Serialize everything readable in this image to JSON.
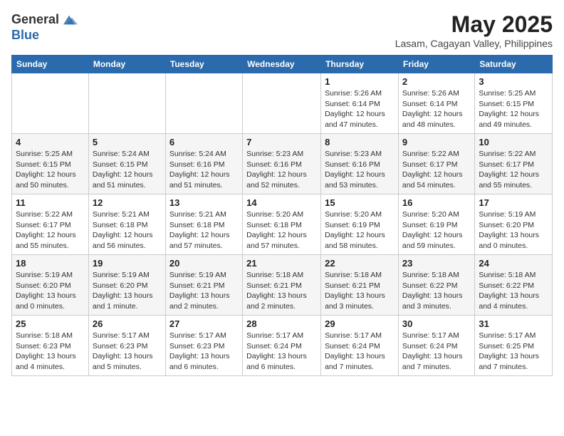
{
  "logo": {
    "general": "General",
    "blue": "Blue"
  },
  "header": {
    "month": "May 2025",
    "location": "Lasam, Cagayan Valley, Philippines"
  },
  "weekdays": [
    "Sunday",
    "Monday",
    "Tuesday",
    "Wednesday",
    "Thursday",
    "Friday",
    "Saturday"
  ],
  "weeks": [
    [
      {
        "day": "",
        "sunrise": "",
        "sunset": "",
        "daylight": ""
      },
      {
        "day": "",
        "sunrise": "",
        "sunset": "",
        "daylight": ""
      },
      {
        "day": "",
        "sunrise": "",
        "sunset": "",
        "daylight": ""
      },
      {
        "day": "",
        "sunrise": "",
        "sunset": "",
        "daylight": ""
      },
      {
        "day": "1",
        "sunrise": "Sunrise: 5:26 AM",
        "sunset": "Sunset: 6:14 PM",
        "daylight": "Daylight: 12 hours and 47 minutes."
      },
      {
        "day": "2",
        "sunrise": "Sunrise: 5:26 AM",
        "sunset": "Sunset: 6:14 PM",
        "daylight": "Daylight: 12 hours and 48 minutes."
      },
      {
        "day": "3",
        "sunrise": "Sunrise: 5:25 AM",
        "sunset": "Sunset: 6:15 PM",
        "daylight": "Daylight: 12 hours and 49 minutes."
      }
    ],
    [
      {
        "day": "4",
        "sunrise": "Sunrise: 5:25 AM",
        "sunset": "Sunset: 6:15 PM",
        "daylight": "Daylight: 12 hours and 50 minutes."
      },
      {
        "day": "5",
        "sunrise": "Sunrise: 5:24 AM",
        "sunset": "Sunset: 6:15 PM",
        "daylight": "Daylight: 12 hours and 51 minutes."
      },
      {
        "day": "6",
        "sunrise": "Sunrise: 5:24 AM",
        "sunset": "Sunset: 6:16 PM",
        "daylight": "Daylight: 12 hours and 51 minutes."
      },
      {
        "day": "7",
        "sunrise": "Sunrise: 5:23 AM",
        "sunset": "Sunset: 6:16 PM",
        "daylight": "Daylight: 12 hours and 52 minutes."
      },
      {
        "day": "8",
        "sunrise": "Sunrise: 5:23 AM",
        "sunset": "Sunset: 6:16 PM",
        "daylight": "Daylight: 12 hours and 53 minutes."
      },
      {
        "day": "9",
        "sunrise": "Sunrise: 5:22 AM",
        "sunset": "Sunset: 6:17 PM",
        "daylight": "Daylight: 12 hours and 54 minutes."
      },
      {
        "day": "10",
        "sunrise": "Sunrise: 5:22 AM",
        "sunset": "Sunset: 6:17 PM",
        "daylight": "Daylight: 12 hours and 55 minutes."
      }
    ],
    [
      {
        "day": "11",
        "sunrise": "Sunrise: 5:22 AM",
        "sunset": "Sunset: 6:17 PM",
        "daylight": "Daylight: 12 hours and 55 minutes."
      },
      {
        "day": "12",
        "sunrise": "Sunrise: 5:21 AM",
        "sunset": "Sunset: 6:18 PM",
        "daylight": "Daylight: 12 hours and 56 minutes."
      },
      {
        "day": "13",
        "sunrise": "Sunrise: 5:21 AM",
        "sunset": "Sunset: 6:18 PM",
        "daylight": "Daylight: 12 hours and 57 minutes."
      },
      {
        "day": "14",
        "sunrise": "Sunrise: 5:20 AM",
        "sunset": "Sunset: 6:18 PM",
        "daylight": "Daylight: 12 hours and 57 minutes."
      },
      {
        "day": "15",
        "sunrise": "Sunrise: 5:20 AM",
        "sunset": "Sunset: 6:19 PM",
        "daylight": "Daylight: 12 hours and 58 minutes."
      },
      {
        "day": "16",
        "sunrise": "Sunrise: 5:20 AM",
        "sunset": "Sunset: 6:19 PM",
        "daylight": "Daylight: 12 hours and 59 minutes."
      },
      {
        "day": "17",
        "sunrise": "Sunrise: 5:19 AM",
        "sunset": "Sunset: 6:20 PM",
        "daylight": "Daylight: 13 hours and 0 minutes."
      }
    ],
    [
      {
        "day": "18",
        "sunrise": "Sunrise: 5:19 AM",
        "sunset": "Sunset: 6:20 PM",
        "daylight": "Daylight: 13 hours and 0 minutes."
      },
      {
        "day": "19",
        "sunrise": "Sunrise: 5:19 AM",
        "sunset": "Sunset: 6:20 PM",
        "daylight": "Daylight: 13 hours and 1 minute."
      },
      {
        "day": "20",
        "sunrise": "Sunrise: 5:19 AM",
        "sunset": "Sunset: 6:21 PM",
        "daylight": "Daylight: 13 hours and 2 minutes."
      },
      {
        "day": "21",
        "sunrise": "Sunrise: 5:18 AM",
        "sunset": "Sunset: 6:21 PM",
        "daylight": "Daylight: 13 hours and 2 minutes."
      },
      {
        "day": "22",
        "sunrise": "Sunrise: 5:18 AM",
        "sunset": "Sunset: 6:21 PM",
        "daylight": "Daylight: 13 hours and 3 minutes."
      },
      {
        "day": "23",
        "sunrise": "Sunrise: 5:18 AM",
        "sunset": "Sunset: 6:22 PM",
        "daylight": "Daylight: 13 hours and 3 minutes."
      },
      {
        "day": "24",
        "sunrise": "Sunrise: 5:18 AM",
        "sunset": "Sunset: 6:22 PM",
        "daylight": "Daylight: 13 hours and 4 minutes."
      }
    ],
    [
      {
        "day": "25",
        "sunrise": "Sunrise: 5:18 AM",
        "sunset": "Sunset: 6:23 PM",
        "daylight": "Daylight: 13 hours and 4 minutes."
      },
      {
        "day": "26",
        "sunrise": "Sunrise: 5:17 AM",
        "sunset": "Sunset: 6:23 PM",
        "daylight": "Daylight: 13 hours and 5 minutes."
      },
      {
        "day": "27",
        "sunrise": "Sunrise: 5:17 AM",
        "sunset": "Sunset: 6:23 PM",
        "daylight": "Daylight: 13 hours and 6 minutes."
      },
      {
        "day": "28",
        "sunrise": "Sunrise: 5:17 AM",
        "sunset": "Sunset: 6:24 PM",
        "daylight": "Daylight: 13 hours and 6 minutes."
      },
      {
        "day": "29",
        "sunrise": "Sunrise: 5:17 AM",
        "sunset": "Sunset: 6:24 PM",
        "daylight": "Daylight: 13 hours and 7 minutes."
      },
      {
        "day": "30",
        "sunrise": "Sunrise: 5:17 AM",
        "sunset": "Sunset: 6:24 PM",
        "daylight": "Daylight: 13 hours and 7 minutes."
      },
      {
        "day": "31",
        "sunrise": "Sunrise: 5:17 AM",
        "sunset": "Sunset: 6:25 PM",
        "daylight": "Daylight: 13 hours and 7 minutes."
      }
    ]
  ]
}
